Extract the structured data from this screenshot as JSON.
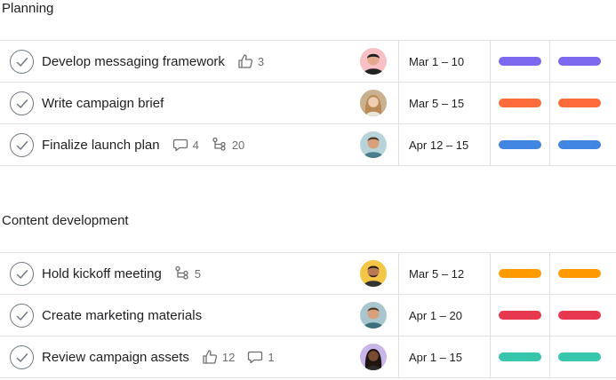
{
  "sections": [
    {
      "title": "Planning",
      "tasks": [
        {
          "name": "Develop messaging framework",
          "likes": "3",
          "date": "Mar 1 – 10",
          "color": "#7b68ee",
          "avatar": "avatar-1"
        },
        {
          "name": "Write campaign brief",
          "date": "Mar 5 – 15",
          "color": "#fc6b3a",
          "avatar": "avatar-2"
        },
        {
          "name": "Finalize launch plan",
          "comments": "4",
          "subtasks": "20",
          "date": "Apr 12 – 15",
          "color": "#4186e0",
          "avatar": "avatar-3"
        }
      ]
    },
    {
      "title": "Content development",
      "tasks": [
        {
          "name": "Hold kickoff meeting",
          "subtasks": "5",
          "date": "Mar 5 – 12",
          "color": "#fd9a00",
          "avatar": "avatar-4"
        },
        {
          "name": "Create marketing materials",
          "date": "Apr 1 – 20",
          "color": "#e8384f",
          "avatar": "avatar-5"
        },
        {
          "name": "Review campaign assets",
          "likes": "12",
          "comments": "1",
          "date": "Apr 1 – 15",
          "color": "#37c5ab",
          "avatar": "avatar-6"
        }
      ]
    }
  ]
}
